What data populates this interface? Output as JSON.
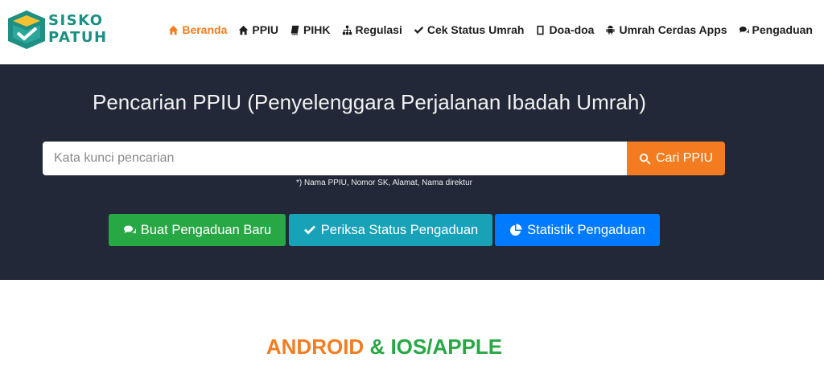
{
  "logo": {
    "line1": "SISKO",
    "line2": "PATUH"
  },
  "nav": {
    "items": [
      {
        "label": "Beranda",
        "icon": "home-icon",
        "active": true
      },
      {
        "label": "PPIU",
        "icon": "home-icon"
      },
      {
        "label": "PIHK",
        "icon": "book-icon"
      },
      {
        "label": "Regulasi",
        "icon": "sitemap-icon"
      },
      {
        "label": "Cek Status Umrah",
        "icon": "check-icon"
      },
      {
        "label": "Doa-doa",
        "icon": "book-icon"
      },
      {
        "label": "Umrah Cerdas Apps",
        "icon": "android-icon"
      },
      {
        "label": "Pengaduan",
        "icon": "comments-icon"
      }
    ]
  },
  "hero": {
    "title": "Pencarian PPIU (Penyelenggara Perjalanan Ibadah Umrah)",
    "search_placeholder": "Kata kunci pencarian",
    "search_value": "",
    "search_button": "Cari PPIU",
    "hint": "*) Nama PPIU, Nomor SK, Alamat, Nama direktur",
    "buttons": {
      "new_complaint": "Buat Pengaduan Baru",
      "check_status": "Periksa Status Pengaduan",
      "statistics": "Statistik Pengaduan"
    }
  },
  "apps": {
    "part1": "ANDROID",
    "part2": "& IOS/APPLE"
  },
  "colors": {
    "accent_orange": "#f47c20",
    "hero_bg": "#232838",
    "green": "#28a745",
    "teal": "#17a2b8",
    "blue": "#007bff",
    "logo_teal": "#1a8f83"
  }
}
